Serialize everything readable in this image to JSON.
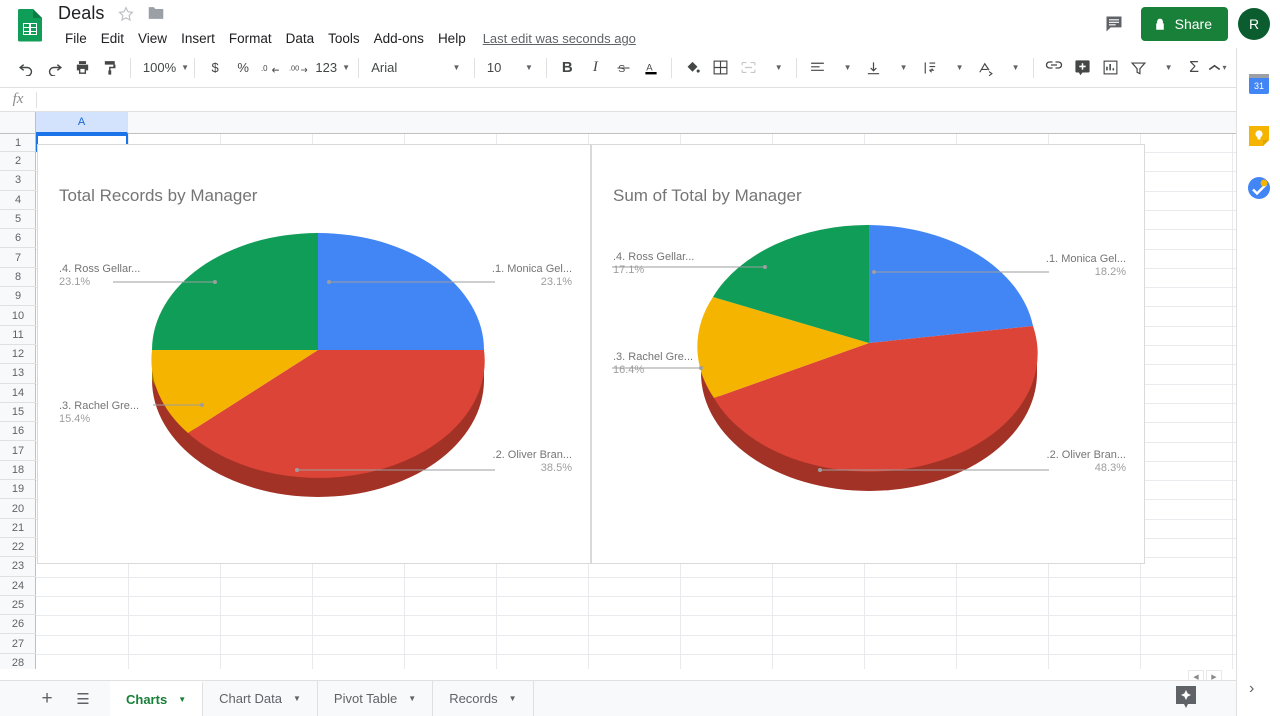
{
  "app": {
    "doc_title": "Deals",
    "last_edit": "Last edit was seconds ago",
    "share_label": "Share",
    "avatar_initial": "R",
    "menus": [
      "File",
      "Edit",
      "View",
      "Insert",
      "Format",
      "Data",
      "Tools",
      "Add-ons",
      "Help"
    ]
  },
  "toolbar": {
    "zoom": "100%",
    "currency": "$",
    "percent": "%",
    "dec_dec": ".0",
    "dec_inc": ".00",
    "num_format": "123",
    "font": "Arial",
    "font_size": "10",
    "bold": "B",
    "italic": "I",
    "strike": "S",
    "text_color": "A",
    "sigma": "Σ"
  },
  "formula_bar": {
    "value": "",
    "fx": "fx"
  },
  "grid": {
    "columns": [
      "A"
    ],
    "rows": [
      "1",
      "2",
      "3",
      "4",
      "5",
      "6",
      "7",
      "8",
      "9",
      "10",
      "11",
      "12",
      "13",
      "14",
      "15",
      "16",
      "17",
      "18",
      "19",
      "20",
      "21",
      "22",
      "23",
      "24",
      "25",
      "26",
      "27",
      "28"
    ],
    "selected_cell": "A1"
  },
  "sheet_tabs": {
    "add_label": "+",
    "all_sheets_label": "☰",
    "tabs": [
      {
        "label": "Charts",
        "active": true
      },
      {
        "label": "Chart Data",
        "active": false
      },
      {
        "label": "Pivot Table",
        "active": false
      },
      {
        "label": "Records",
        "active": false
      }
    ]
  },
  "side_panel": {
    "items": [
      "calendar-icon",
      "keep-icon",
      "tasks-icon"
    ],
    "expand_label": "›"
  },
  "chart_data": [
    {
      "type": "pie",
      "title": "Total Records by Manager",
      "categories": [
        ".1. Monica Gel...",
        ".2. Oliver Bran...",
        ".3. Rachel Gre...",
        ".4. Ross Gellar..."
      ],
      "values": [
        23.1,
        38.5,
        15.4,
        23.1
      ],
      "percent_labels": [
        "23.1%",
        "38.5%",
        "15.4%",
        "23.1%"
      ],
      "colors": [
        "#4285F4",
        "#DB4437",
        "#F4B400",
        "#0F9D58"
      ],
      "three_d": true,
      "legend": "labeled",
      "xlabel": "",
      "ylabel": ""
    },
    {
      "type": "pie",
      "title": "Sum of Total by Manager",
      "categories": [
        ".1. Monica Gel...",
        ".2. Oliver Bran...",
        ".3. Rachel Gre...",
        ".4. Ross Gellar..."
      ],
      "values": [
        18.2,
        48.3,
        16.4,
        17.1
      ],
      "percent_labels": [
        "18.2%",
        "48.3%",
        "16.4%",
        "17.1%"
      ],
      "colors": [
        "#4285F4",
        "#DB4437",
        "#F4B400",
        "#0F9D58"
      ],
      "three_d": true,
      "legend": "labeled",
      "xlabel": "",
      "ylabel": ""
    }
  ]
}
